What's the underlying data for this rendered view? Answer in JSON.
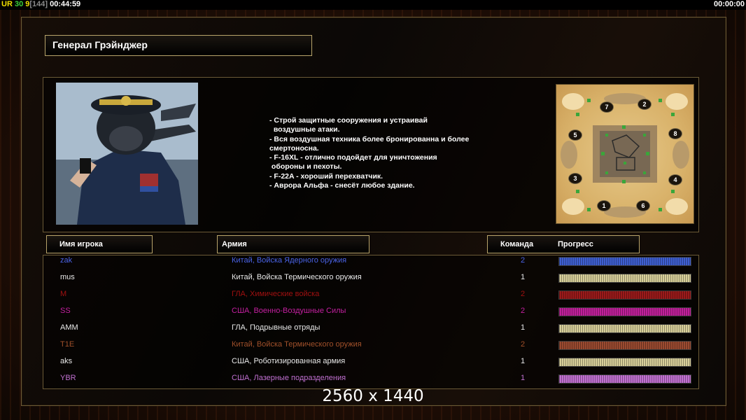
{
  "hud": {
    "ur": "UR",
    "level": "30",
    "count": "9",
    "bracket": "[144]",
    "timer_left": "00:44:59",
    "timer_right": "00:00:00"
  },
  "general": {
    "title": "Генерал Грэйнджер"
  },
  "description": "- Строй защитные сооружения и устраивай\n  воздушные атаки.\n- Вся воздушная техника более бронированна и более\nсмертоносна.\n- F-16XL - отлично подойдет для уничтожения\n обороны и пехоты.\n- F-22A - хороший перехватчик.\n- Аврора Альфа - снесёт любое здание.",
  "minimap": {
    "spawns": [
      "7",
      "2",
      "5",
      "8",
      "3",
      "4",
      "1",
      "6"
    ]
  },
  "table": {
    "headers": {
      "player": "Имя игрока",
      "army": "Армия",
      "team": "Команда",
      "progress": "Прогресс"
    },
    "rows": [
      {
        "name": "zak",
        "army": "Китай, Войска Ядерного оружия",
        "team": "2",
        "color": "#4a63e6",
        "progress": 1.0
      },
      {
        "name": "mus",
        "army": "Китай, Войска Термического оружия",
        "team": "1",
        "color": "#e8e8e8",
        "progress": 1.0
      },
      {
        "name": "M",
        "army": "ГЛА, Химические войска",
        "team": "2",
        "color": "#a01010",
        "progress": 1.0
      },
      {
        "name": "SS",
        "army": "США, Военно-Воздушные Силы",
        "team": "2",
        "color": "#c420a0",
        "progress": 1.0
      },
      {
        "name": "AMM",
        "army": "ГЛА, Подрывные отряды",
        "team": "1",
        "color": "#e8e8e8",
        "progress": 1.0
      },
      {
        "name": "T1E",
        "army": "Китай, Войска Термического оружия",
        "team": "2",
        "color": "#a0502a",
        "progress": 1.0
      },
      {
        "name": "aks",
        "army": "США, Роботизированная армия",
        "team": "1",
        "color": "#e8e8e8",
        "progress": 1.0
      },
      {
        "name": "YBR",
        "army": "США, Лазерные подразделения",
        "team": "1",
        "color": "#c070d0",
        "progress": 1.0
      }
    ],
    "bar_colors": [
      "#3f5fd0",
      "#d8cf9a",
      "#9a1a1a",
      "#c0209a",
      "#d8cf9a",
      "#9a4a30",
      "#d8cf9a",
      "#c070d0"
    ]
  },
  "resolution_label": "2560 x 1440"
}
